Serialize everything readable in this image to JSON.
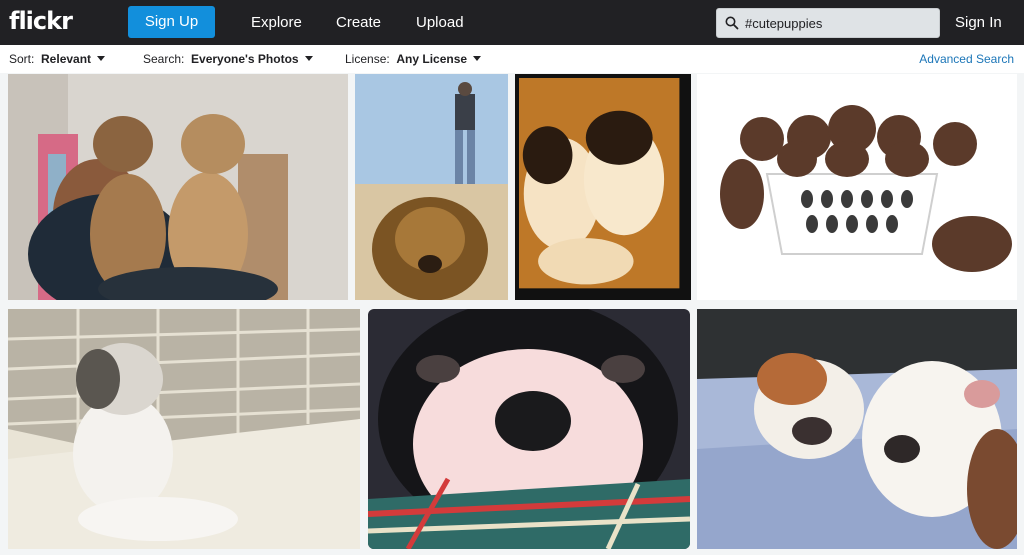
{
  "header": {
    "logo": "flickr",
    "signup_label": "Sign Up",
    "nav": [
      "Explore",
      "Create",
      "Upload"
    ],
    "search_value": "#cutepuppies",
    "signin_label": "Sign In"
  },
  "filters": {
    "sort_label": "Sort:",
    "sort_value": "Relevant",
    "search_label": "Search:",
    "search_value": "Everyone's Photos",
    "license_label": "License:",
    "license_value": "Any License",
    "advanced_label": "Advanced Search"
  },
  "photos": [
    {
      "desc": "two-terriers-held"
    },
    {
      "desc": "puppy-with-man-on-beach"
    },
    {
      "desc": "two-sepia-puppies"
    },
    {
      "desc": "poodle-puppies-in-basket"
    },
    {
      "desc": "fluffy-puppy-by-wall"
    },
    {
      "desc": "closeup-puppy-nose"
    },
    {
      "desc": "bulldog-puppies-on-bed"
    }
  ]
}
